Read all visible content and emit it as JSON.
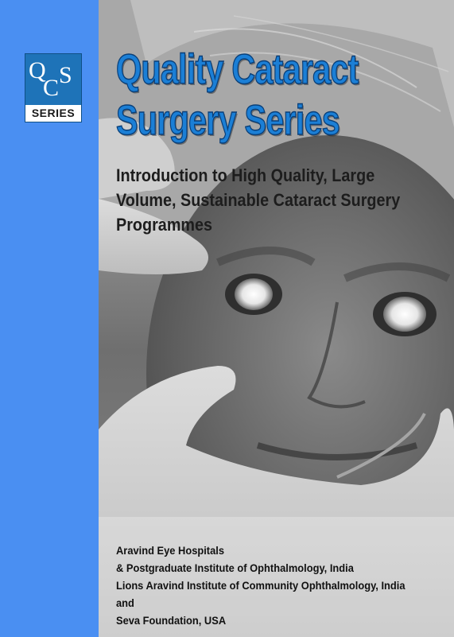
{
  "logo": {
    "letters": [
      "Q",
      "C",
      "S"
    ],
    "label": "SERIES",
    "color": "#1e73b8"
  },
  "cover": {
    "title_lines": [
      "Quality Cataract",
      "Surgery Series"
    ],
    "subtitle_lines": [
      "Introduction to High Quality, Large",
      "Volume, Sustainable Cataract Surgery",
      "Programmes"
    ],
    "publishers": [
      "Aravind Eye Hospitals",
      "& Postgraduate Institute of Ophthalmology, India",
      "Lions Aravind Institute of Community Ophthalmology, India",
      "and",
      "Seva Foundation, USA"
    ],
    "title_color": "#1b7fd6",
    "band_color": "#4a8ff2"
  }
}
